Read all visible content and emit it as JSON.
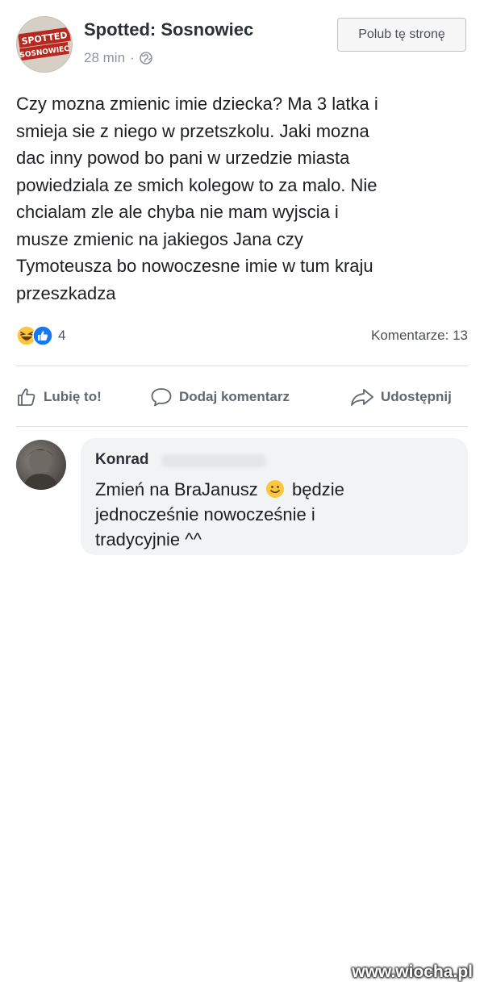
{
  "post": {
    "page_name": "Spotted: Sosnowiec",
    "avatar_text_top": "SPOTTED",
    "avatar_text_bottom": "SOSNOWIEC",
    "time": "28 min",
    "separator": "·",
    "privacy_icon": "globe-icon",
    "like_page_button": "Polub tę stronę",
    "text_lines": [
      "Czy mozna zmienic imie dziecka? Ma 3 latka i",
      "smieja sie z niego w przetszkolu. Jaki mozna",
      "dac inny powod bo pani w urzedzie miasta",
      "powiedziala ze smich kolegow to za malo. Nie",
      "chcialam zle ale chyba nie mam wyjscia i",
      "musze zmienic na jakiegos Jana czy",
      "Tymoteusza bo nowoczesne imie w tum kraju",
      "przeszkadza"
    ],
    "reaction_icons": [
      "haha-emoji-icon",
      "like-reaction-icon"
    ],
    "reaction_count": "4",
    "comments_count": "Komentarze: 13"
  },
  "actions": {
    "like": "Lubię to!",
    "comment": "Dodaj komentarz",
    "share": "Udostępnij"
  },
  "comment": {
    "author": "Konrad",
    "lines": [
      "Zmień na BraJanusz",
      "będzie",
      "jednocześnie nowocześnie i",
      "tradycyjnie ^^"
    ],
    "emoji": "smile-emoji-icon"
  },
  "watermark": "www.wiocha.pl",
  "colors": {
    "text": "#1c1e21",
    "secondary": "#8d949e",
    "like_blue": "#1877f2",
    "haha_yellow": "#fcc63e",
    "bubble": "#f2f3f5"
  }
}
